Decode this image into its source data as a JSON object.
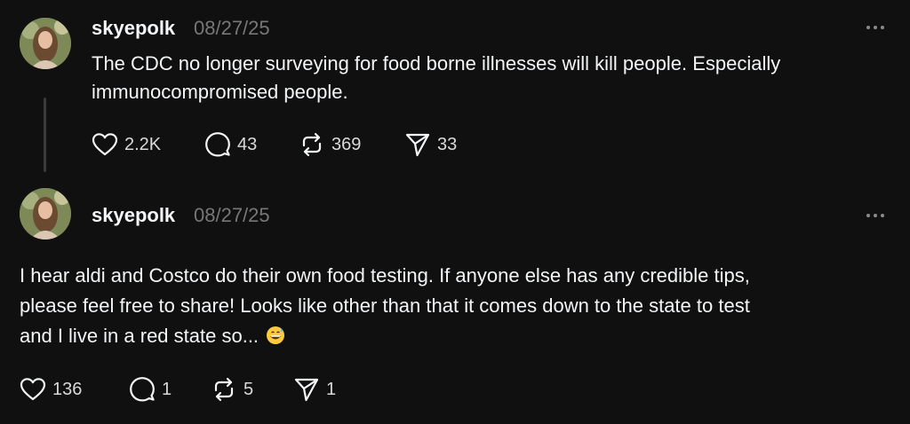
{
  "posts": [
    {
      "username": "skyepolk",
      "date": "08/27/25",
      "lines": [
        "The CDC no longer surveying for food borne illnesses will kill people. Especially",
        "immunocompromised people."
      ],
      "likes": "2.2K",
      "replies": "43",
      "reposts": "369",
      "shares": "33"
    },
    {
      "username": "skyepolk",
      "date": "08/27/25",
      "lines": [
        "I hear aldi and Costco do their own food testing. If anyone else has any credible tips,",
        "please feel free to share! Looks like other than that it comes down to the state to test",
        "and I live in a red state so..."
      ],
      "emoji": "grinning-sweat-emoji",
      "likes": "136",
      "replies": "1",
      "reposts": "5",
      "shares": "1"
    }
  ],
  "icons": {
    "like": "heart-icon",
    "reply": "comment-icon",
    "repost": "repost-icon",
    "share": "send-icon",
    "more": "more-horizontal-icon"
  },
  "colors": {
    "background": "#101010",
    "text": "#f3f5f7",
    "secondary": "#777777",
    "thread_line": "#3a3a3a"
  }
}
